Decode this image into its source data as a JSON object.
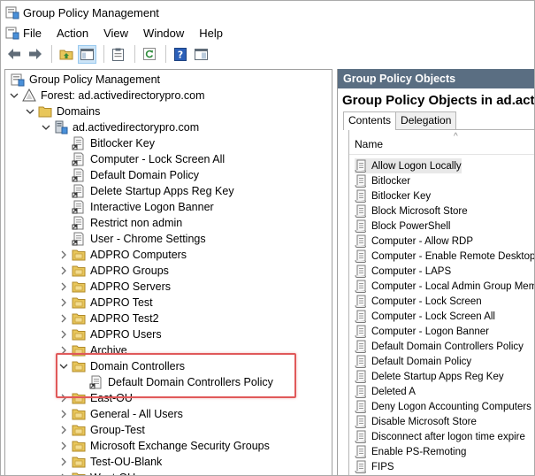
{
  "window": {
    "title": "Group Policy Management"
  },
  "menu": {
    "items": [
      "File",
      "Action",
      "View",
      "Window",
      "Help"
    ]
  },
  "toolbar": {
    "icons": [
      "back-arrow-icon",
      "forward-arrow-icon",
      "folder-up-icon",
      "show-hide-tree-icon",
      "properties-icon",
      "refresh-icon",
      "help-icon",
      "console-icon"
    ]
  },
  "tree": {
    "root": "Group Policy Management",
    "forest": "Forest: ad.activedirectorypro.com",
    "domains": "Domains",
    "domain": "ad.activedirectorypro.com",
    "gpo_links": [
      "Bitlocker Key",
      "Computer - Lock Screen All",
      "Default Domain Policy",
      "Delete Startup Apps Reg Key",
      "Interactive Logon Banner",
      "Restrict non admin",
      "User - Chrome Settings"
    ],
    "ous_top": [
      "ADPRO Computers",
      "ADPRO Groups",
      "ADPRO Servers",
      "ADPRO Test",
      "ADPRO Test2",
      "ADPRO Users",
      "Archive"
    ],
    "domain_controllers": "Domain Controllers",
    "dc_policy": "Default Domain Controllers Policy",
    "ous_bottom": [
      "East-OU",
      "General - All Users",
      "Group-Test",
      "Microsoft Exchange Security Groups",
      "Test-OU-Blank",
      "West-OU"
    ]
  },
  "right": {
    "header": "Group Policy Objects",
    "title": "Group Policy Objects in ad.activ",
    "tabs": [
      "Contents",
      "Delegation"
    ],
    "active_tab": "Contents",
    "column": "Name",
    "items": [
      "Allow Logon Locally",
      "Bitlocker",
      "Bitlocker Key",
      "Block Microsoft Store",
      "Block PowerShell",
      "Computer - Allow RDP",
      "Computer - Enable Remote Desktop.",
      "Computer - LAPS",
      "Computer - Local Admin Group Member",
      "Computer - Lock Screen",
      "Computer - Lock Screen All",
      "Computer - Logon Banner",
      "Default Domain Controllers Policy",
      "Default Domain Policy",
      "Delete Startup Apps Reg Key",
      "Deleted A",
      "Deny Logon Accounting Computers",
      "Disable Microsoft Store",
      "Disconnect after logon time expire",
      "Enable PS-Remoting",
      "FIPS"
    ],
    "selected_index": 0
  },
  "colors": {
    "highlight": "#e0595a",
    "panel_header": "#5a6e82",
    "folder": "#e8c65a"
  }
}
